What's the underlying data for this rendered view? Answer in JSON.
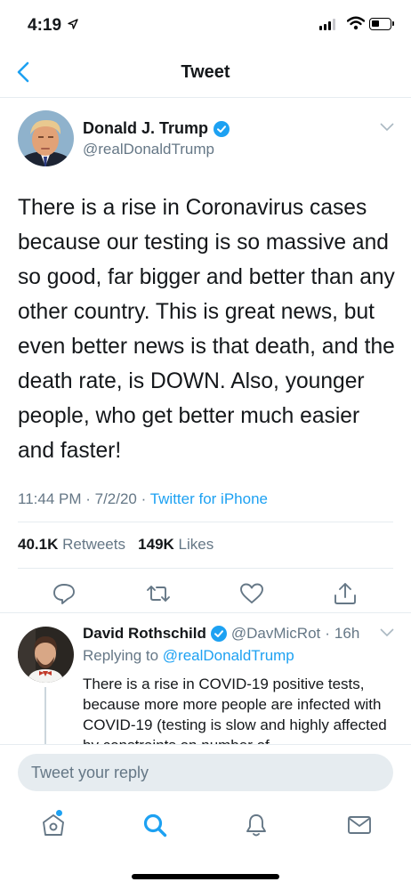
{
  "status_bar": {
    "time": "4:19",
    "battery_level": 0.45
  },
  "nav": {
    "title": "Tweet"
  },
  "tweet": {
    "author_name": "Donald J. Trump",
    "author_handle": "@realDonaldTrump",
    "text": "There is a rise in Coronavirus cases because our testing is so massive and so good, far bigger and better than any other country. This is great news, but even better news is that death, and the death rate, is DOWN. Also, younger people, who get better much easier and faster!",
    "time": "11:44 PM",
    "date": "7/2/20",
    "source": "Twitter for iPhone",
    "retweets_count": "40.1K",
    "retweets_label": "Retweets",
    "likes_count": "149K",
    "likes_label": "Likes"
  },
  "reply": {
    "author_name": "David Rothschild",
    "author_handle": "@DavMicRot",
    "age": "16h",
    "replying_to_prefix": "Replying to",
    "replying_to_handle": "@realDonaldTrump",
    "text": "There is a rise in COVID-19 positive tests, because more more people are infected with COVID-19 (testing is slow and highly affected by constraints on number of"
  },
  "composer": {
    "placeholder": "Tweet your reply"
  },
  "colors": {
    "accent": "#1da1f2",
    "muted": "#657786",
    "text": "#14171a",
    "divider": "#e6ecf0"
  },
  "icons": {
    "actions": [
      "reply-icon",
      "retweet-icon",
      "like-icon",
      "share-icon"
    ],
    "tabs": [
      "home-icon",
      "search-icon",
      "notifications-icon",
      "messages-icon"
    ]
  }
}
